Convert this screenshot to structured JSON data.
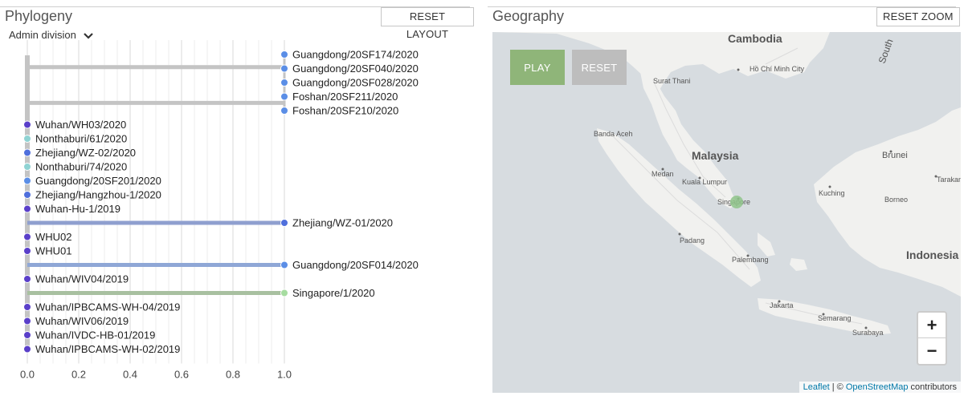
{
  "phylogeny": {
    "title": "Phylogeny",
    "reset_layout_label": "RESET LAYOUT",
    "admin_selector_label": "Admin division",
    "axis_ticks": [
      "0.0",
      "0.2",
      "0.4",
      "0.6",
      "0.8",
      "1.0"
    ],
    "tips": [
      {
        "label": "Guangdong/20SF174/2020",
        "divergence": 1.0,
        "color": "#5b8ee6"
      },
      {
        "label": "Guangdong/20SF040/2020",
        "divergence": 1.0,
        "color": "#5b8ee6"
      },
      {
        "label": "Guangdong/20SF028/2020",
        "divergence": 1.0,
        "color": "#5b8ee6"
      },
      {
        "label": "Foshan/20SF211/2020",
        "divergence": 1.0,
        "color": "#5b8ee6"
      },
      {
        "label": "Foshan/20SF210/2020",
        "divergence": 1.0,
        "color": "#5b8ee6"
      },
      {
        "label": "Wuhan/WH03/2020",
        "divergence": 0.0,
        "color": "#5a3fc9"
      },
      {
        "label": "Nonthaburi/61/2020",
        "divergence": 0.0,
        "color": "#8fd3d3"
      },
      {
        "label": "Zhejiang/WZ-02/2020",
        "divergence": 0.0,
        "color": "#4f6fdc"
      },
      {
        "label": "Nonthaburi/74/2020",
        "divergence": 0.0,
        "color": "#8fd3d3"
      },
      {
        "label": "Guangdong/20SF201/2020",
        "divergence": 0.0,
        "color": "#5b8ee6"
      },
      {
        "label": "Zhejiang/Hangzhou-1/2020",
        "divergence": 0.0,
        "color": "#4f6fdc"
      },
      {
        "label": "Wuhan-Hu-1/2019",
        "divergence": 0.0,
        "color": "#5a3fc9"
      },
      {
        "label": "Zhejiang/WZ-01/2020",
        "divergence": 1.0,
        "color": "#4f6fdc",
        "branch_color": "#8f9fcf"
      },
      {
        "label": "WHU02",
        "divergence": 0.0,
        "color": "#5a3fc9"
      },
      {
        "label": "WHU01",
        "divergence": 0.0,
        "color": "#5a3fc9"
      },
      {
        "label": "Guangdong/20SF014/2020",
        "divergence": 1.0,
        "color": "#5b8ee6",
        "branch_color": "#8fa7d6"
      },
      {
        "label": "Wuhan/WIV04/2019",
        "divergence": 0.0,
        "color": "#5a3fc9"
      },
      {
        "label": "Singapore/1/2020",
        "divergence": 1.0,
        "color": "#a6dca0",
        "branch_color": "#a8c0a0"
      },
      {
        "label": "Wuhan/IPBCAMS-WH-04/2019",
        "divergence": 0.0,
        "color": "#5a3fc9"
      },
      {
        "label": "Wuhan/WIV06/2019",
        "divergence": 0.0,
        "color": "#5a3fc9"
      },
      {
        "label": "Wuhan/IVDC-HB-01/2019",
        "divergence": 0.0,
        "color": "#5a3fc9"
      },
      {
        "label": "Wuhan/IPBCAMS-WH-02/2019",
        "divergence": 0.0,
        "color": "#5a3fc9"
      }
    ],
    "clades": [
      {
        "from_tip": 0,
        "to_tip": 2,
        "divergence": 0.0
      },
      {
        "from_tip": 3,
        "to_tip": 4,
        "divergence": 0.0
      }
    ]
  },
  "geography": {
    "title": "Geography",
    "reset_zoom_label": "RESET ZOOM",
    "play_label": "PLAY",
    "reset_label": "RESET",
    "zoom_in_label": "+",
    "zoom_out_label": "−",
    "attribution": {
      "leaflet": "Leaflet",
      "separator": " | © ",
      "osm": "OpenStreetMap",
      "suffix": " contributors"
    },
    "places": {
      "cambodia": "Cambodia",
      "ho_chi_minh": "Hồ Chí Minh City",
      "surat_thani": "Surat Thani",
      "banda_aceh": "Banda Aceh",
      "malaysia": "Malaysia",
      "medan": "Medan",
      "kuala_lumpur": "Kuala Lumpur",
      "singapore": "Singapore",
      "brunei": "Brunei",
      "tarakan": "Tarakan",
      "kuching": "Kuching",
      "borneo": "Borneo",
      "padang": "Padang",
      "palembang": "Palembang",
      "indonesia": "Indonesia",
      "jakarta": "Jakarta",
      "semarang": "Semarang",
      "surabaya": "Surabaya",
      "south_china_sea": "South"
    },
    "marker": {
      "location": "Singapore",
      "color": "#8fc48a"
    }
  }
}
